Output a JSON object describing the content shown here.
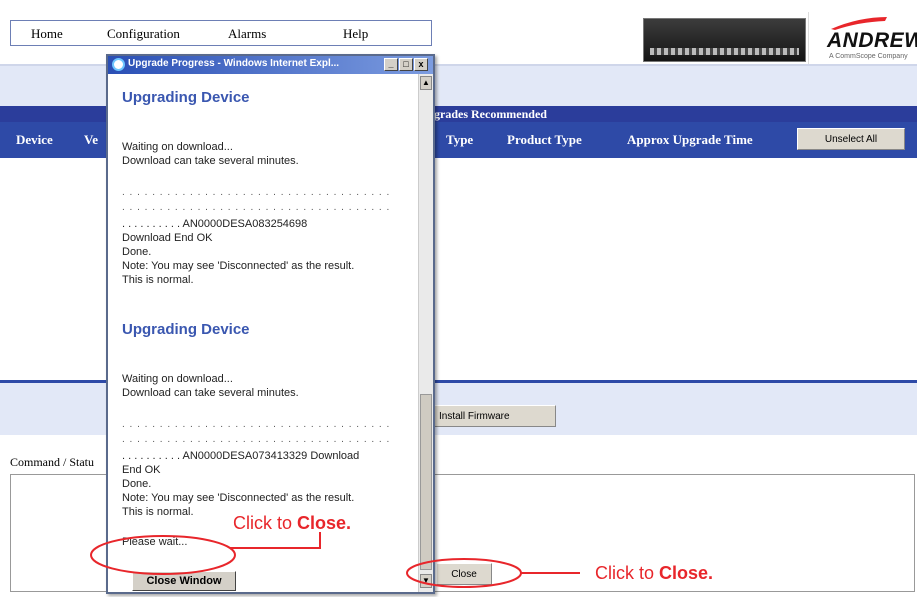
{
  "menu": {
    "items": [
      "Home",
      "Configuration",
      "Alarms",
      "Help"
    ]
  },
  "brand": {
    "logo_text": "ANDREW",
    "logo_subtitle": "A CommScope Company"
  },
  "table": {
    "banner_title": "grades Recommended",
    "headers": {
      "device": "Device",
      "version": "Ve",
      "type": "Type",
      "product_type": "Product Type",
      "upgrade_time": "Approx Upgrade Time"
    },
    "unselect_all_label": "Unselect All"
  },
  "actions": {
    "install_firmware_label": "Install Firmware",
    "command_status_label": "Command / Statu",
    "close_label": "Close"
  },
  "popup": {
    "title": "Upgrade Progress - Windows Internet Expl...",
    "min_glyph": "_",
    "max_glyph": "□",
    "close_glyph": "x",
    "section1": {
      "title": "Upgrading Device",
      "waiting": "Waiting on download...",
      "can_take": "Download can take several minutes.",
      "dots1": ". . . . . . . . . . . . . . . . . . . . . . . . . . . . . . . . . . . .",
      "dots2": ". . . . . . . . . . . . . . . . . . . . . . . . . . . . . . . . . . . .",
      "device_line": ". . . . . . . . . . AN0000DESA083254698",
      "end_ok": "Download End OK",
      "done": "Done.",
      "note": "Note: You may see 'Disconnected' as the result.",
      "normal": "This is normal."
    },
    "section2": {
      "title": "Upgrading Device",
      "waiting": "Waiting on download...",
      "can_take": "Download can take several minutes.",
      "dots1": ". . . . . . . . . . . . . . . . . . . . . . . . . . . . . . . . . . . .",
      "dots2": ". . . . . . . . . . . . . . . . . . . . . . . . . . . . . . . . . . . .",
      "device_line": ". . . . . . . . . . AN0000DESA073413329 Download",
      "end_ok": "End OK",
      "done": "Done.",
      "note": "Note: You may see 'Disconnected' as the result.",
      "normal": "This is normal."
    },
    "please_wait": "Please wait...",
    "close_window_label": "Close Window"
  },
  "callouts": {
    "left": {
      "prefix": "Click to ",
      "bold": "Close."
    },
    "right": {
      "prefix": "Click to ",
      "bold": "Close."
    }
  },
  "colors": {
    "navy": "#2b3d9b",
    "header_blue": "#2e4aa7",
    "band": "#e2e8f7",
    "callout_red": "#e8262b",
    "popup_heading": "#3a57b0"
  }
}
